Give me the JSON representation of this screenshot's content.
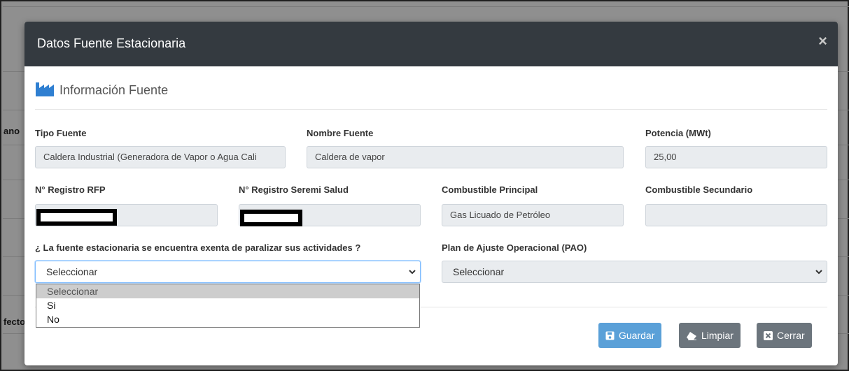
{
  "background": {
    "text_1": "ano",
    "text_2": "fecto"
  },
  "modal": {
    "title": "Datos Fuente Estacionaria",
    "close_glyph": "×",
    "section_title": "Información Fuente",
    "section_icon": "factory-icon"
  },
  "fields": {
    "tipo_fuente": {
      "label": "Tipo Fuente",
      "value": "Caldera Industrial (Generadora de Vapor o Agua Cali"
    },
    "nombre_fuente": {
      "label": "Nombre Fuente",
      "value": "Caldera de vapor"
    },
    "potencia": {
      "label": "Potencia (MWt)",
      "value": "25,00"
    },
    "registro_rfp": {
      "label": "N° Registro RFP",
      "value": ""
    },
    "registro_seremi": {
      "label": "N° Registro Seremi Salud",
      "value": ""
    },
    "combustible_principal": {
      "label": "Combustible Principal",
      "value": "Gas Licuado de Petróleo"
    },
    "combustible_secundario": {
      "label": "Combustible Secundario",
      "value": ""
    }
  },
  "exenta": {
    "label": "¿ La fuente estacionaria se encuentra exenta de paralizar sus actividades ?",
    "selected": "Seleccionar",
    "options": [
      "Seleccionar",
      "Si",
      "No"
    ]
  },
  "pao": {
    "label": "Plan de Ajuste Operacional (PAO)",
    "selected": "Seleccionar"
  },
  "buttons": {
    "guardar": "Guardar",
    "limpiar": "Limpiar",
    "cerrar": "Cerrar"
  },
  "colors": {
    "header": "#343a40",
    "primary": "#5aa0d8",
    "secondary": "#6c757d",
    "icon_blue": "#2f7fd1"
  }
}
